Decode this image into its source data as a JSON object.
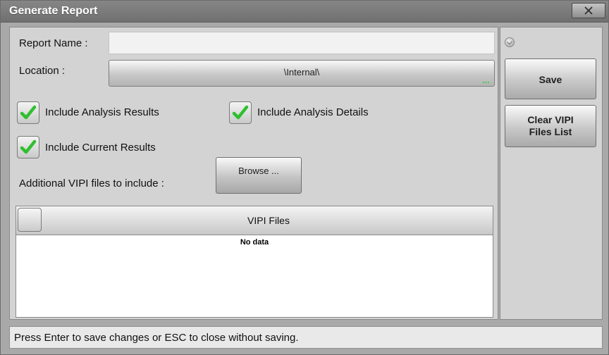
{
  "window": {
    "title": "Generate Report"
  },
  "form": {
    "report_name_label": "Report Name :",
    "report_name_value": "",
    "location_label": "Location :",
    "location_value": "\\Internal\\",
    "location_more": "...",
    "options": [
      {
        "label": "Include Analysis Results",
        "checked": true
      },
      {
        "label": "Include Analysis Details",
        "checked": true
      },
      {
        "label": "Include Current Results",
        "checked": true
      }
    ],
    "additional_label": "Additional VIPI files to include :",
    "browse_label": "Browse ..."
  },
  "grid": {
    "column_title": "VIPI Files",
    "empty_text": "No data",
    "rows": []
  },
  "side": {
    "save_label": "Save",
    "clear_label_line1": "Clear VIPI",
    "clear_label_line2": "Files List"
  },
  "status": {
    "text": "Press Enter to save changes or ESC to close without saving."
  },
  "icons": {
    "check": "check-icon",
    "close": "close-icon"
  },
  "colors": {
    "check_green": "#2fbf2f",
    "more_dots_green": "#3bd13b",
    "title_bar": "#707070"
  }
}
